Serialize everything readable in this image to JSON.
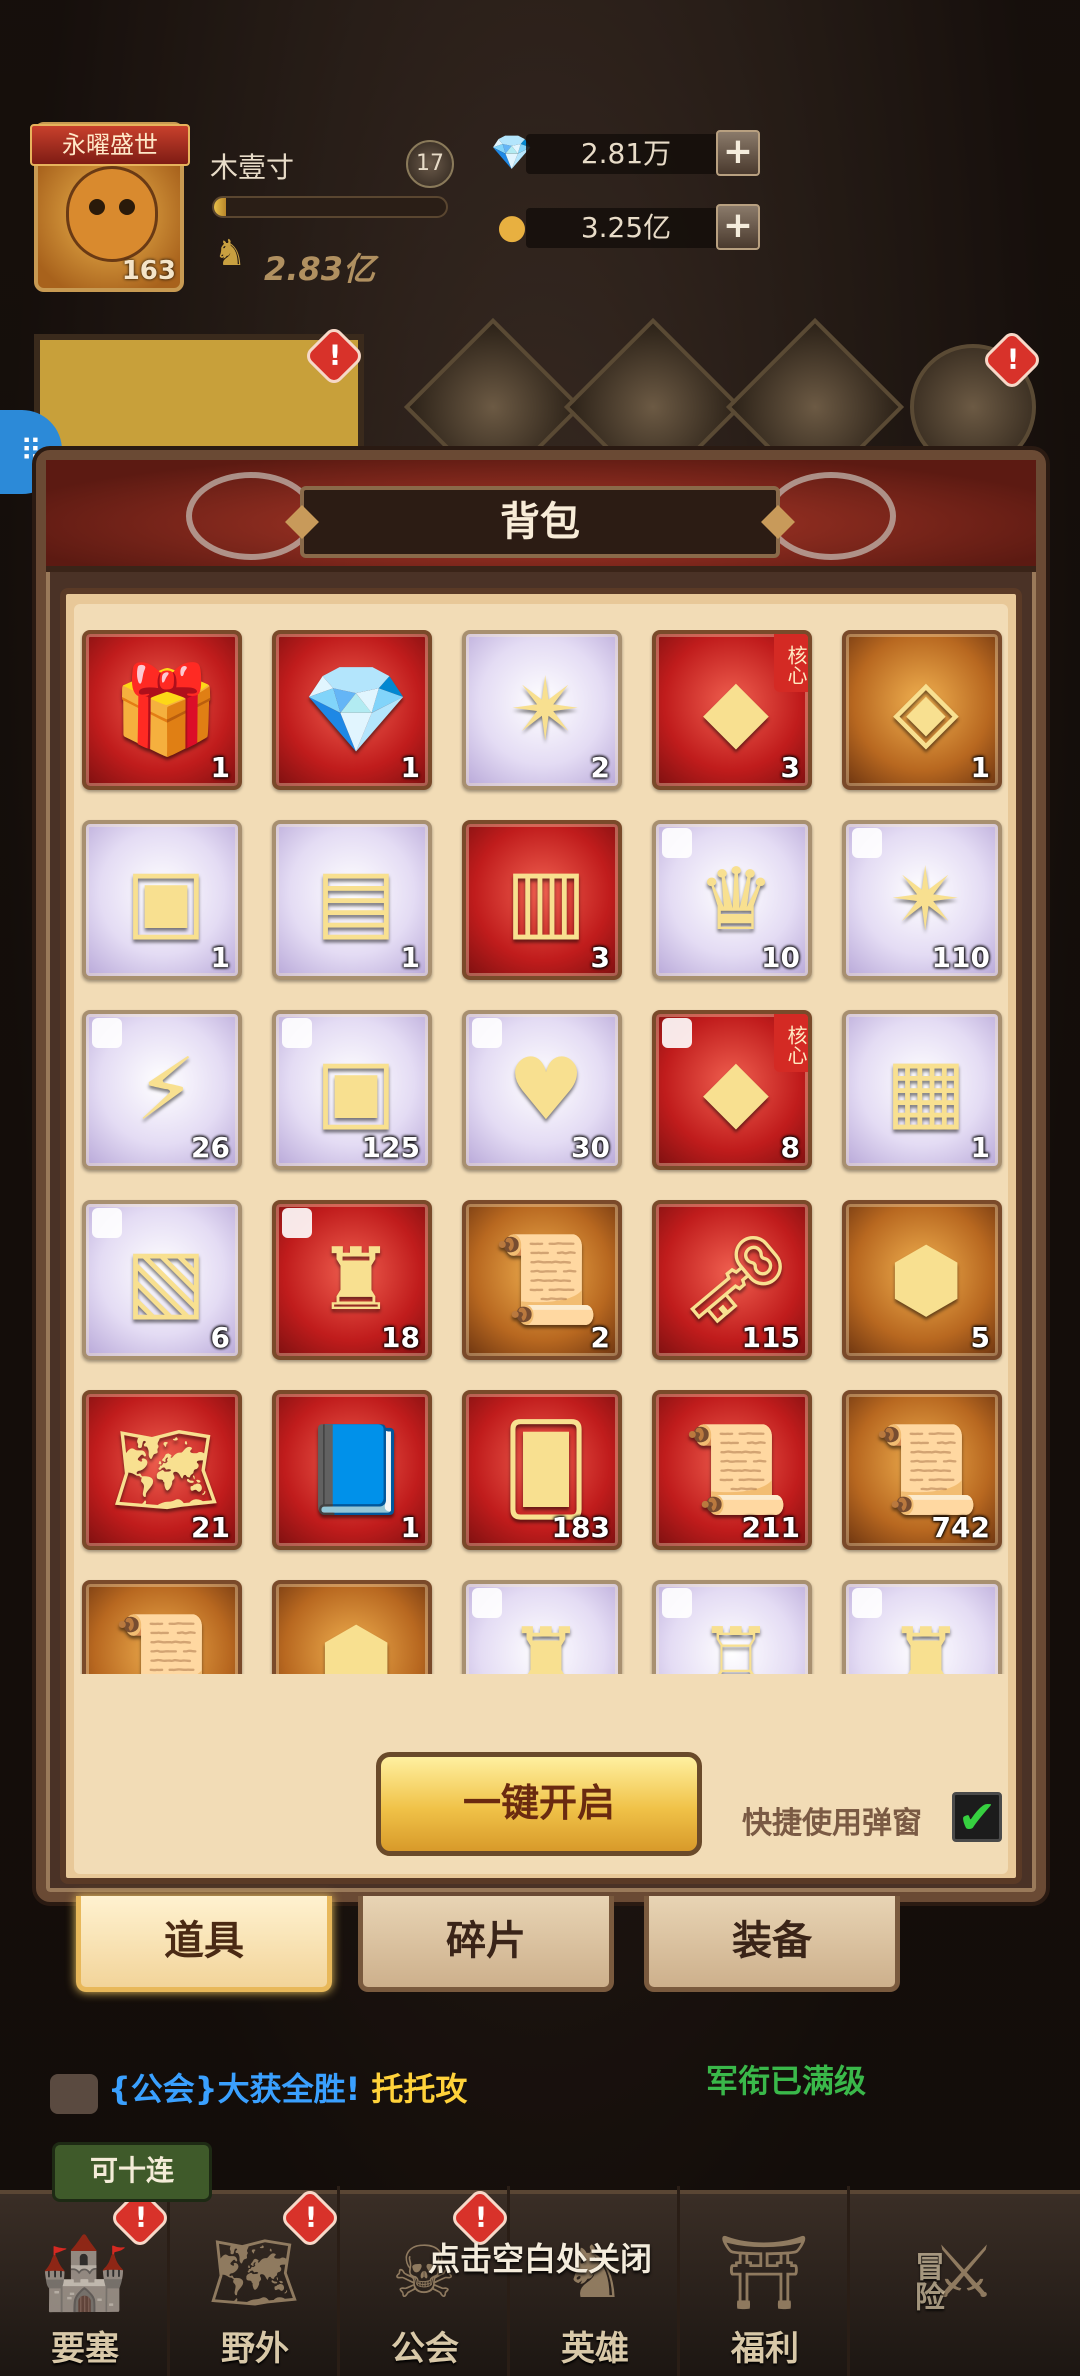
{
  "hud": {
    "title": "永曜盛世",
    "player_name": "木壹寸",
    "level": "17",
    "avatar_level": "163",
    "power": "2.83亿",
    "exp_progress": 0.05,
    "diamonds": "2.81万",
    "gold": "3.25亿",
    "plus": "+",
    "alert": "!"
  },
  "panel": {
    "title": "背包",
    "open_all": "一键开启",
    "quick_use": "快捷使用弹窗",
    "quick_use_checked": "✔"
  },
  "items": [
    {
      "icon": "gift-box",
      "glyph": "🎁",
      "rarity": "red",
      "qty": "1"
    },
    {
      "icon": "gem-pouch",
      "glyph": "💎",
      "rarity": "red",
      "qty": "1"
    },
    {
      "icon": "star-card",
      "glyph": "✴",
      "rarity": "white",
      "qty": "2"
    },
    {
      "icon": "core-card",
      "glyph": "◆",
      "rarity": "red",
      "qty": "3",
      "tag": "核心"
    },
    {
      "icon": "purple-card",
      "glyph": "◈",
      "rarity": "gold",
      "qty": "1"
    },
    {
      "icon": "crystal-chest",
      "glyph": "▣",
      "rarity": "white",
      "qty": "1"
    },
    {
      "icon": "paw-chest",
      "glyph": "▤",
      "rarity": "white",
      "qty": "1"
    },
    {
      "icon": "jewel-chest",
      "glyph": "▥",
      "rarity": "red",
      "qty": "3"
    },
    {
      "icon": "crown-chest-fragment",
      "glyph": "♛",
      "rarity": "white",
      "qty": "10",
      "fragment": true
    },
    {
      "icon": "star-card-fragment",
      "glyph": "✴",
      "rarity": "white",
      "qty": "110",
      "fragment": true
    },
    {
      "icon": "lightning-chest-fragment",
      "glyph": "⚡",
      "rarity": "white",
      "qty": "26",
      "fragment": true
    },
    {
      "icon": "crystal-chest-fragment",
      "glyph": "▣",
      "rarity": "white",
      "qty": "125",
      "fragment": true
    },
    {
      "icon": "heart-chest-fragment",
      "glyph": "♥",
      "rarity": "white",
      "qty": "30",
      "fragment": true
    },
    {
      "icon": "core-card-fragment",
      "glyph": "◆",
      "rarity": "red",
      "qty": "8",
      "tag": "核心",
      "fragment": true
    },
    {
      "icon": "royal-chest",
      "glyph": "▦",
      "rarity": "white",
      "qty": "1"
    },
    {
      "icon": "rune-chest-fragment",
      "glyph": "▧",
      "rarity": "white",
      "qty": "6",
      "fragment": true
    },
    {
      "icon": "horn-chest-fragment",
      "glyph": "♜",
      "rarity": "red",
      "qty": "18",
      "fragment": true
    },
    {
      "icon": "paw-scroll",
      "glyph": "📜",
      "rarity": "gold",
      "qty": "2"
    },
    {
      "icon": "golden-key",
      "glyph": "🗝",
      "rarity": "red",
      "qty": "115"
    },
    {
      "icon": "gold-ore",
      "glyph": "⬢",
      "rarity": "gold",
      "qty": "5"
    },
    {
      "icon": "treasure-map",
      "glyph": "🗺",
      "rarity": "red",
      "qty": "21"
    },
    {
      "icon": "blue-book",
      "glyph": "📘",
      "rarity": "red",
      "qty": "1"
    },
    {
      "icon": "silver-card",
      "glyph": "🂠",
      "rarity": "red",
      "qty": "183"
    },
    {
      "icon": "orange-scroll",
      "glyph": "📜",
      "rarity": "red",
      "qty": "211"
    },
    {
      "icon": "purple-scroll",
      "glyph": "📜",
      "rarity": "gold",
      "qty": "742"
    },
    {
      "icon": "fire-scroll",
      "glyph": "📜",
      "rarity": "gold",
      "qty": ""
    },
    {
      "icon": "amber-ore",
      "glyph": "⬢",
      "rarity": "gold",
      "qty": ""
    },
    {
      "icon": "dark-castle-fragment",
      "glyph": "♜",
      "rarity": "white",
      "qty": "",
      "fragment": true
    },
    {
      "icon": "tower-fragment",
      "glyph": "♖",
      "rarity": "white",
      "qty": "",
      "fragment": true
    },
    {
      "icon": "spire-fragment",
      "glyph": "♜",
      "rarity": "white",
      "qty": "",
      "fragment": true
    }
  ],
  "tabs": [
    "道具",
    "碎片",
    "装备"
  ],
  "chat": {
    "channel": "{公会}",
    "message": "大获全胜!",
    "highlight": "托托攻",
    "rank_msg": "军衔已满级"
  },
  "ten_pull": "可十连",
  "close_hint": "点击空白处关闭",
  "nav": [
    "要塞",
    "野外",
    "公会",
    "英雄",
    "福利",
    "冒险"
  ],
  "colors": {
    "accent_gold": "#f0c248",
    "panel_parchment": "#f2dcb6",
    "alert_red": "#d8322a",
    "chat_blue": "#3aa0ff",
    "rank_green": "#3ab84a"
  }
}
